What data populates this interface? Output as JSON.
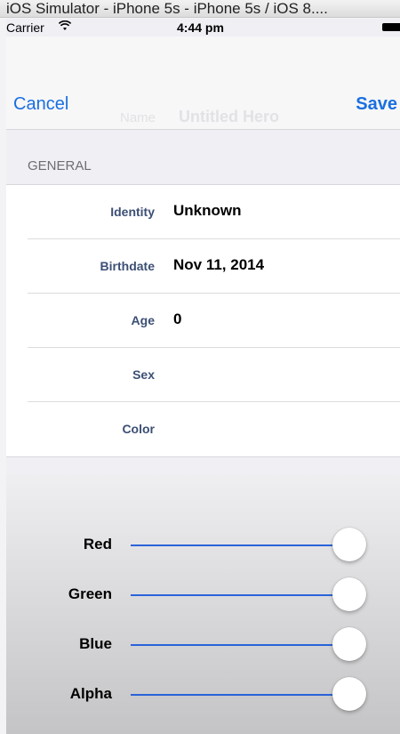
{
  "simulator": {
    "title": "iOS Simulator - iPhone 5s - iPhone 5s / iOS 8...."
  },
  "status_bar": {
    "carrier": "Carrier",
    "wifi_icon": "wifi-icon",
    "time": "4:44 pm",
    "battery_icon": "battery-icon"
  },
  "nav": {
    "cancel_label": "Cancel",
    "save_label": "Save",
    "ghost_field_label": "Name",
    "ghost_field_value": "Untitled Hero"
  },
  "section": {
    "header": "GENERAL"
  },
  "rows": [
    {
      "label": "Identity",
      "value": "Unknown"
    },
    {
      "label": "Birthdate",
      "value": "Nov 11, 2014"
    },
    {
      "label": "Age",
      "value": "0"
    },
    {
      "label": "Sex",
      "value": ""
    },
    {
      "label": "Color",
      "value": ""
    }
  ],
  "color_picker": {
    "sliders": [
      {
        "label": "Red",
        "value": 1.0
      },
      {
        "label": "Green",
        "value": 1.0
      },
      {
        "label": "Blue",
        "value": 1.0
      },
      {
        "label": "Alpha",
        "value": 1.0
      }
    ],
    "track_color": "#2a63d9"
  },
  "colors": {
    "accent": "#1a6fe0",
    "label_text": "#3c4f74",
    "section_header": "#6d6d72"
  }
}
